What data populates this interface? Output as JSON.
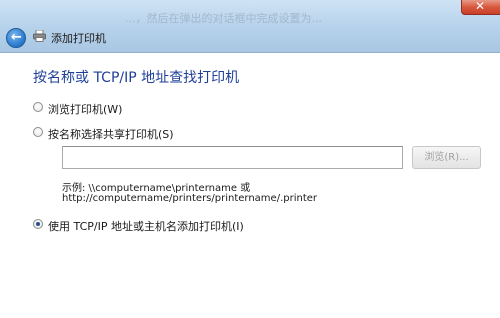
{
  "window": {
    "title": "添加打印机",
    "background_text": "...，然后在弹出的对话框中完成设置为..."
  },
  "page": {
    "heading": "按名称或 TCP/IP 地址查找打印机"
  },
  "options": {
    "browse": {
      "label": "浏览打印机(W)",
      "selected": false
    },
    "shared": {
      "label": "按名称选择共享打印机(S)",
      "selected": false,
      "input_value": "",
      "browse_button": "浏览(R)...",
      "example_line1": "示例: \\\\computername\\printername 或",
      "example_line2": "http://computername/printers/printername/.printer"
    },
    "tcpip": {
      "label": "使用 TCP/IP 地址或主机名添加打印机(I)",
      "selected": true
    }
  },
  "icons": {
    "back": "back-arrow-icon",
    "printer": "printer-icon",
    "close": "close-icon"
  },
  "colors": {
    "heading": "#1f3f99",
    "titlebar": "#b9d4ec",
    "close": "#d8593d"
  }
}
